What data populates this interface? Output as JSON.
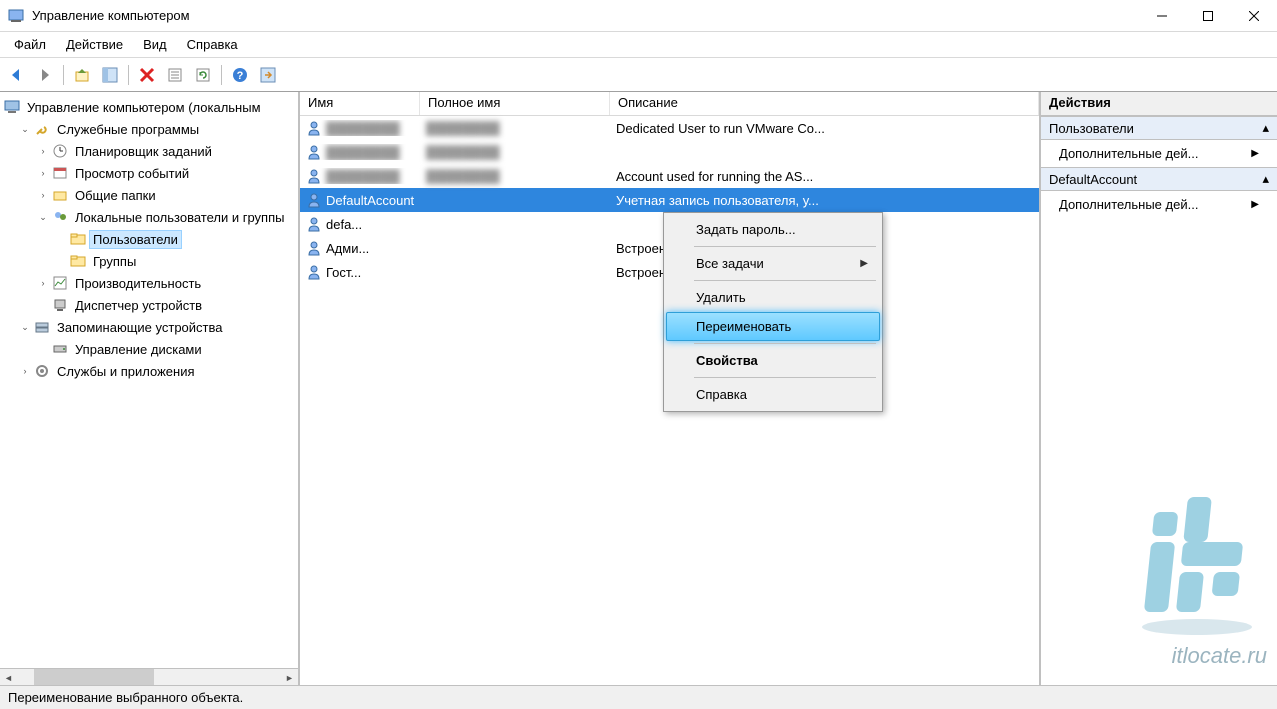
{
  "window": {
    "title": "Управление компьютером"
  },
  "menu": {
    "file": "Файл",
    "action": "Действие",
    "view": "Вид",
    "help": "Справка"
  },
  "tree": {
    "root": "Управление компьютером (локальным",
    "system_tools": "Служебные программы",
    "task_scheduler": "Планировщик заданий",
    "event_viewer": "Просмотр событий",
    "shared_folders": "Общие папки",
    "local_users": "Локальные пользователи и группы",
    "users": "Пользователи",
    "groups": "Группы",
    "performance": "Производительность",
    "device_manager": "Диспетчер устройств",
    "storage": "Запоминающие устройства",
    "disk_management": "Управление дисками",
    "services_apps": "Службы и приложения"
  },
  "list": {
    "columns": {
      "name": "Имя",
      "fullname": "Полное имя",
      "description": "Описание"
    },
    "rows": [
      {
        "name": "",
        "full": "",
        "desc": "Dedicated User to run VMware Co...",
        "blur": true
      },
      {
        "name": "",
        "full": "",
        "desc": "",
        "blur": true
      },
      {
        "name": "",
        "full": "",
        "desc": "Account used for running the AS...",
        "blur": true
      },
      {
        "name": "DefaultAccount",
        "full": "",
        "desc": "Учетная запись пользователя, у...",
        "selected": true
      },
      {
        "name": "defa...",
        "full": "",
        "desc": ""
      },
      {
        "name": "Адми...",
        "full": "",
        "desc": "Встроенная учетная запись адм..."
      },
      {
        "name": "Гост...",
        "full": "",
        "desc": "Встроенная учетная запись для ..."
      }
    ]
  },
  "context_menu": {
    "set_password": "Задать пароль...",
    "all_tasks": "Все задачи",
    "delete": "Удалить",
    "rename": "Переименовать",
    "properties": "Свойства",
    "help": "Справка"
  },
  "actions": {
    "header": "Действия",
    "section1": "Пользователи",
    "more1": "Дополнительные дей...",
    "section2": "DefaultAccount",
    "more2": "Дополнительные дей..."
  },
  "status": "Переименование выбранного объекта.",
  "watermark": {
    "text": "itlocate.ru"
  }
}
